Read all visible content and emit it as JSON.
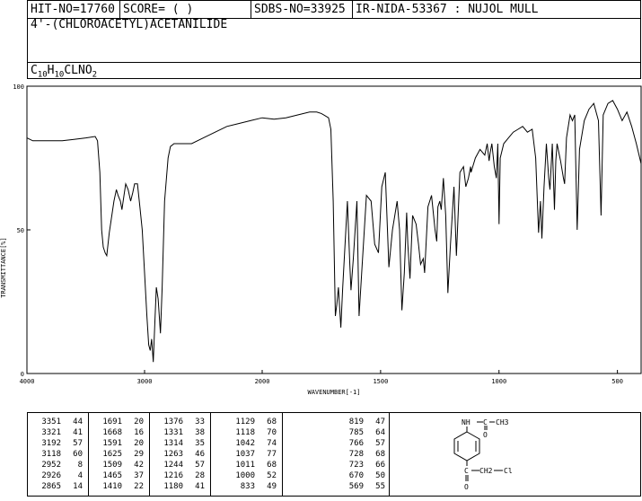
{
  "header": {
    "hit_no": "HIT-NO=17760",
    "score": "SCORE=  (    )",
    "sdbs_no": "SDBS-NO=33925",
    "ir_nida": "IR-NIDA-53367 : NUJOL MULL",
    "compound_name": "4'-(CHLOROACETYL)ACETANILIDE",
    "formula": {
      "c": "C",
      "c_n": "10",
      "h": "H",
      "h_n": "10",
      "rest": "CLNO",
      "o_n": "2"
    }
  },
  "structure": {
    "top_group": "NH",
    "c_label": "C",
    "ch3_label": "CH3",
    "o_label": "O",
    "ch2_label": "CH2",
    "cl_label": "Cl"
  },
  "chart_data": {
    "type": "line",
    "title": "",
    "xlabel": "WAVENUMBER[-1]",
    "ylabel": "TRANSMITTANCE[%]",
    "xlim": [
      4000,
      400
    ],
    "ylim": [
      0,
      100
    ],
    "x_ticks": [
      "4000",
      "3000",
      "2000",
      "1500",
      "1000",
      "500"
    ],
    "y_ticks": [
      "0",
      "50",
      "100"
    ],
    "grid": false,
    "series": [
      {
        "name": "",
        "points": [
          [
            4000,
            82
          ],
          [
            3950,
            81
          ],
          [
            3900,
            81
          ],
          [
            3800,
            81
          ],
          [
            3700,
            81
          ],
          [
            3600,
            81.5
          ],
          [
            3500,
            82
          ],
          [
            3420,
            82.5
          ],
          [
            3400,
            81
          ],
          [
            3380,
            70
          ],
          [
            3365,
            50
          ],
          [
            3351,
            44
          ],
          [
            3335,
            42
          ],
          [
            3321,
            41
          ],
          [
            3300,
            49
          ],
          [
            3260,
            60
          ],
          [
            3240,
            64
          ],
          [
            3225,
            62
          ],
          [
            3205,
            60
          ],
          [
            3192,
            57
          ],
          [
            3175,
            62
          ],
          [
            3160,
            66
          ],
          [
            3140,
            64
          ],
          [
            3118,
            60
          ],
          [
            3100,
            63
          ],
          [
            3085,
            66
          ],
          [
            3060,
            66
          ],
          [
            3040,
            58
          ],
          [
            3020,
            50
          ],
          [
            3000,
            35
          ],
          [
            2980,
            20
          ],
          [
            2965,
            10
          ],
          [
            2952,
            8
          ],
          [
            2940,
            12
          ],
          [
            2926,
            4
          ],
          [
            2912,
            18
          ],
          [
            2900,
            30
          ],
          [
            2885,
            26
          ],
          [
            2865,
            14
          ],
          [
            2850,
            30
          ],
          [
            2830,
            60
          ],
          [
            2800,
            75
          ],
          [
            2780,
            79
          ],
          [
            2750,
            80
          ],
          [
            2700,
            80
          ],
          [
            2600,
            80
          ],
          [
            2500,
            82
          ],
          [
            2400,
            84
          ],
          [
            2300,
            86
          ],
          [
            2200,
            87
          ],
          [
            2100,
            88
          ],
          [
            2000,
            89
          ],
          [
            1950,
            88.5
          ],
          [
            1900,
            89
          ],
          [
            1850,
            90
          ],
          [
            1800,
            91
          ],
          [
            1770,
            91
          ],
          [
            1750,
            90.5
          ],
          [
            1720,
            89
          ],
          [
            1710,
            85
          ],
          [
            1700,
            60
          ],
          [
            1691,
            20
          ],
          [
            1685,
            24
          ],
          [
            1678,
            30
          ],
          [
            1668,
            16
          ],
          [
            1660,
            30
          ],
          [
            1640,
            60
          ],
          [
            1630,
            38
          ],
          [
            1625,
            29
          ],
          [
            1615,
            40
          ],
          [
            1600,
            60
          ],
          [
            1591,
            20
          ],
          [
            1580,
            35
          ],
          [
            1560,
            62
          ],
          [
            1540,
            60
          ],
          [
            1525,
            45
          ],
          [
            1509,
            42
          ],
          [
            1495,
            65
          ],
          [
            1480,
            70
          ],
          [
            1465,
            37
          ],
          [
            1450,
            50
          ],
          [
            1430,
            60
          ],
          [
            1420,
            50
          ],
          [
            1410,
            22
          ],
          [
            1400,
            35
          ],
          [
            1390,
            56
          ],
          [
            1385,
            45
          ],
          [
            1376,
            33
          ],
          [
            1365,
            55
          ],
          [
            1350,
            52
          ],
          [
            1340,
            45
          ],
          [
            1331,
            38
          ],
          [
            1320,
            40
          ],
          [
            1314,
            35
          ],
          [
            1300,
            58
          ],
          [
            1285,
            62
          ],
          [
            1270,
            50
          ],
          [
            1263,
            46
          ],
          [
            1258,
            58
          ],
          [
            1250,
            60
          ],
          [
            1244,
            57
          ],
          [
            1235,
            68
          ],
          [
            1225,
            55
          ],
          [
            1216,
            28
          ],
          [
            1205,
            45
          ],
          [
            1190,
            65
          ],
          [
            1180,
            41
          ],
          [
            1165,
            70
          ],
          [
            1150,
            72
          ],
          [
            1140,
            65
          ],
          [
            1129,
            68
          ],
          [
            1120,
            72
          ],
          [
            1118,
            70
          ],
          [
            1100,
            75
          ],
          [
            1080,
            78
          ],
          [
            1060,
            76
          ],
          [
            1050,
            80
          ],
          [
            1042,
            74
          ],
          [
            1037,
            77
          ],
          [
            1030,
            80
          ],
          [
            1020,
            72
          ],
          [
            1011,
            68
          ],
          [
            1005,
            80
          ],
          [
            1000,
            52
          ],
          [
            995,
            75
          ],
          [
            980,
            80
          ],
          [
            960,
            82
          ],
          [
            940,
            84
          ],
          [
            920,
            85
          ],
          [
            900,
            86
          ],
          [
            880,
            84
          ],
          [
            860,
            85
          ],
          [
            845,
            75
          ],
          [
            833,
            49
          ],
          [
            825,
            60
          ],
          [
            819,
            47
          ],
          [
            810,
            65
          ],
          [
            800,
            80
          ],
          [
            790,
            68
          ],
          [
            785,
            64
          ],
          [
            775,
            80
          ],
          [
            766,
            57
          ],
          [
            760,
            74
          ],
          [
            755,
            80
          ],
          [
            740,
            74
          ],
          [
            728,
            68
          ],
          [
            723,
            66
          ],
          [
            715,
            82
          ],
          [
            700,
            90
          ],
          [
            690,
            88
          ],
          [
            680,
            90
          ],
          [
            670,
            50
          ],
          [
            660,
            78
          ],
          [
            640,
            88
          ],
          [
            620,
            92
          ],
          [
            600,
            94
          ],
          [
            580,
            88
          ],
          [
            569,
            55
          ],
          [
            560,
            90
          ],
          [
            540,
            94
          ],
          [
            520,
            95
          ],
          [
            500,
            92
          ],
          [
            480,
            88
          ],
          [
            460,
            91
          ],
          [
            440,
            86
          ],
          [
            420,
            80
          ],
          [
            400,
            73
          ]
        ]
      }
    ],
    "peak_table": [
      [
        [
          "3351",
          "44"
        ],
        [
          "3321",
          "41"
        ],
        [
          "3192",
          "57"
        ],
        [
          "3118",
          "60"
        ],
        [
          "2952",
          "8"
        ],
        [
          "2926",
          "4"
        ],
        [
          "2865",
          "14"
        ]
      ],
      [
        [
          "1691",
          "20"
        ],
        [
          "1668",
          "16"
        ],
        [
          "1591",
          "20"
        ],
        [
          "1625",
          "29"
        ],
        [
          "1509",
          "42"
        ],
        [
          "1465",
          "37"
        ],
        [
          "1410",
          "22"
        ]
      ],
      [
        [
          "1376",
          "33"
        ],
        [
          "1331",
          "38"
        ],
        [
          "1314",
          "35"
        ],
        [
          "1263",
          "46"
        ],
        [
          "1244",
          "57"
        ],
        [
          "1216",
          "28"
        ],
        [
          "1180",
          "41"
        ]
      ],
      [
        [
          "1129",
          "68"
        ],
        [
          "1118",
          "70"
        ],
        [
          "1042",
          "74"
        ],
        [
          "1037",
          "77"
        ],
        [
          "1011",
          "68"
        ],
        [
          "1000",
          "52"
        ],
        [
          "833",
          "49"
        ]
      ],
      [
        [
          "819",
          "47"
        ],
        [
          "785",
          "64"
        ],
        [
          "766",
          "57"
        ],
        [
          "728",
          "68"
        ],
        [
          "723",
          "66"
        ],
        [
          "670",
          "50"
        ],
        [
          "569",
          "55"
        ]
      ]
    ]
  }
}
